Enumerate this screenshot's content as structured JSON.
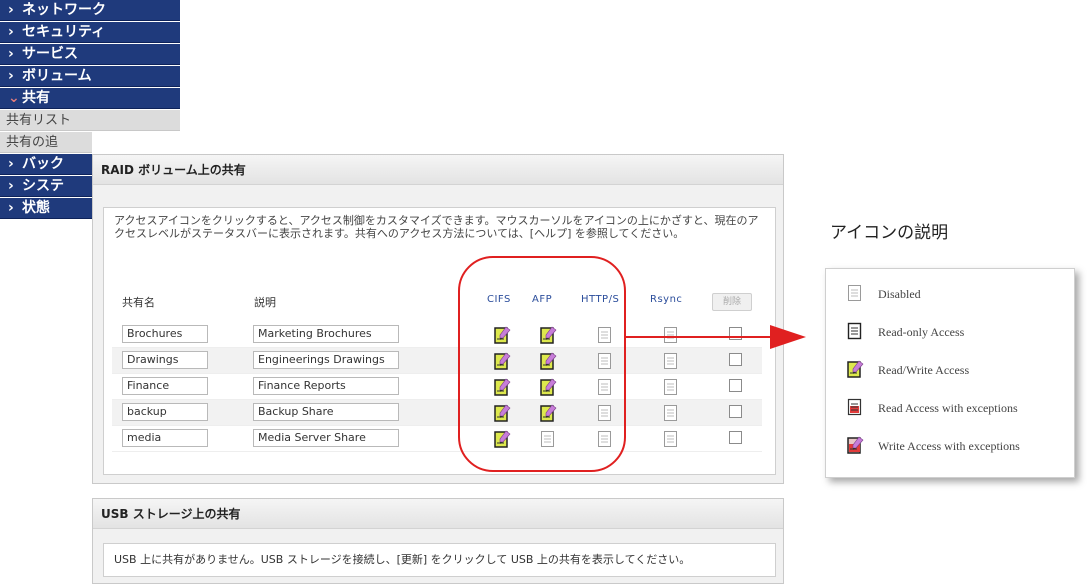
{
  "sidebar": {
    "items": [
      {
        "chevron": "›",
        "label": "ネットワーク"
      },
      {
        "chevron": "›",
        "label": "セキュリティ"
      },
      {
        "chevron": "›",
        "label": "サービス"
      },
      {
        "chevron": "›",
        "label": "ボリューム"
      },
      {
        "chevron": "⌄",
        "label": "共有"
      }
    ],
    "sub_items": [
      {
        "label": "共有リスト"
      },
      {
        "label": "共有の追"
      }
    ],
    "items_after": [
      {
        "chevron": "›",
        "label": "バック"
      },
      {
        "chevron": "›",
        "label": "システ"
      },
      {
        "chevron": "›",
        "label": "状態"
      }
    ]
  },
  "main": {
    "raid_title": "RAID ボリューム上の共有",
    "intro": "アクセスアイコンをクリックすると、アクセス制御をカスタマイズできます。マウスカーソルをアイコンの上にかざすと、現在のアクセスレベルがステータスバーに表示されます。共有へのアクセス方法については、[ヘルプ] を参照してください。",
    "columns": {
      "name": "共有名",
      "desc": "説明",
      "cifs": "CIFS",
      "afp": "AFP",
      "http": "HTTP/S",
      "rsync": "Rsync",
      "delete": "削除"
    },
    "shares": [
      {
        "name": "Brochures",
        "desc": "Marketing Brochures",
        "cifs": "rw",
        "afp": "rw",
        "http": "disabled",
        "rsync": "disabled"
      },
      {
        "name": "Drawings",
        "desc": "Engineerings Drawings",
        "cifs": "rw",
        "afp": "rw",
        "http": "disabled",
        "rsync": "disabled"
      },
      {
        "name": "Finance",
        "desc": "Finance Reports",
        "cifs": "rw",
        "afp": "rw",
        "http": "disabled",
        "rsync": "disabled"
      },
      {
        "name": "backup",
        "desc": "Backup Share",
        "cifs": "rw",
        "afp": "rw",
        "http": "disabled",
        "rsync": "disabled"
      },
      {
        "name": "media",
        "desc": "Media Server Share",
        "cifs": "rw",
        "afp": "disabled",
        "http": "disabled",
        "rsync": "disabled"
      }
    ]
  },
  "usb": {
    "title": "USB ストレージ上の共有",
    "message": "USB 上に共有がありません。USB ストレージを接続し、[更新] をクリックして USB 上の共有を表示してください。"
  },
  "legend": {
    "title": "アイコンの説明",
    "items": [
      {
        "icon": "disabled",
        "label": "Disabled"
      },
      {
        "icon": "ro",
        "label": "Read-only Access"
      },
      {
        "icon": "rw",
        "label": "Read/Write Access"
      },
      {
        "icon": "rx",
        "label": "Read Access with exceptions"
      },
      {
        "icon": "wx",
        "label": "Write Access with exceptions"
      }
    ]
  },
  "colors": {
    "nav_bg": "#1f3a7c",
    "annotation_red": "#e02020",
    "header_blue": "#2b4d9b"
  }
}
